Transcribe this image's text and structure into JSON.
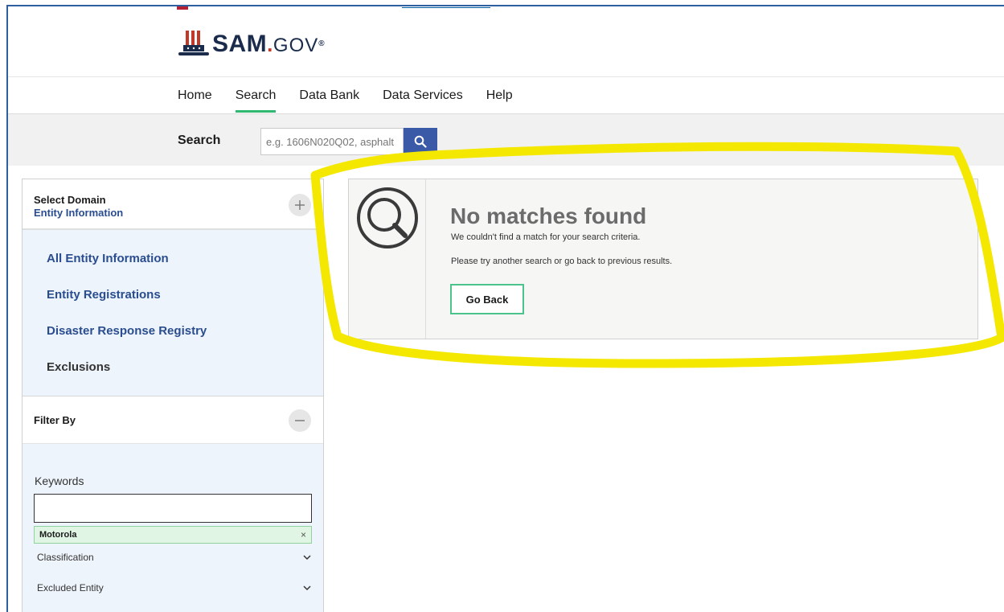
{
  "brand": {
    "name": "SAM",
    "dot": ".",
    "suffix": "GOV",
    "registered": "®"
  },
  "nav": {
    "items": [
      {
        "label": "Home",
        "active": false
      },
      {
        "label": "Search",
        "active": true
      },
      {
        "label": "Data Bank",
        "active": false
      },
      {
        "label": "Data Services",
        "active": false
      },
      {
        "label": "Help",
        "active": false
      }
    ]
  },
  "search": {
    "label": "Search",
    "placeholder": "e.g. 1606N020Q02, asphalt"
  },
  "domain": {
    "title": "Select Domain",
    "value": "Entity Information",
    "items": [
      {
        "label": "All Entity Information",
        "style": "link"
      },
      {
        "label": "Entity Registrations",
        "style": "link"
      },
      {
        "label": "Disaster Response Registry",
        "style": "link"
      },
      {
        "label": "Exclusions",
        "style": "plain"
      }
    ]
  },
  "filter": {
    "title": "Filter By",
    "keywords_label": "Keywords",
    "chip": "Motorola",
    "chip_remove": "×",
    "accordions": [
      {
        "label": "Classification"
      },
      {
        "label": "Excluded Entity"
      }
    ]
  },
  "result": {
    "title": "No matches found",
    "subtitle": "We couldn't find a match for your search criteria.",
    "hint": "Please try another search or go back to previous results.",
    "button": "Go Back"
  },
  "colors": {
    "accent_green": "#2fb870",
    "link_blue": "#2a4d8f",
    "search_button": "#3a5aa8",
    "highlight_yellow": "#f5e800"
  },
  "icons": {
    "search_button": "search-icon",
    "domain_toggle": "plus-icon",
    "filter_toggle": "minus-icon",
    "result": "magnifier-icon",
    "chip_remove": "close-icon",
    "accordion": "chevron-down-icon"
  }
}
